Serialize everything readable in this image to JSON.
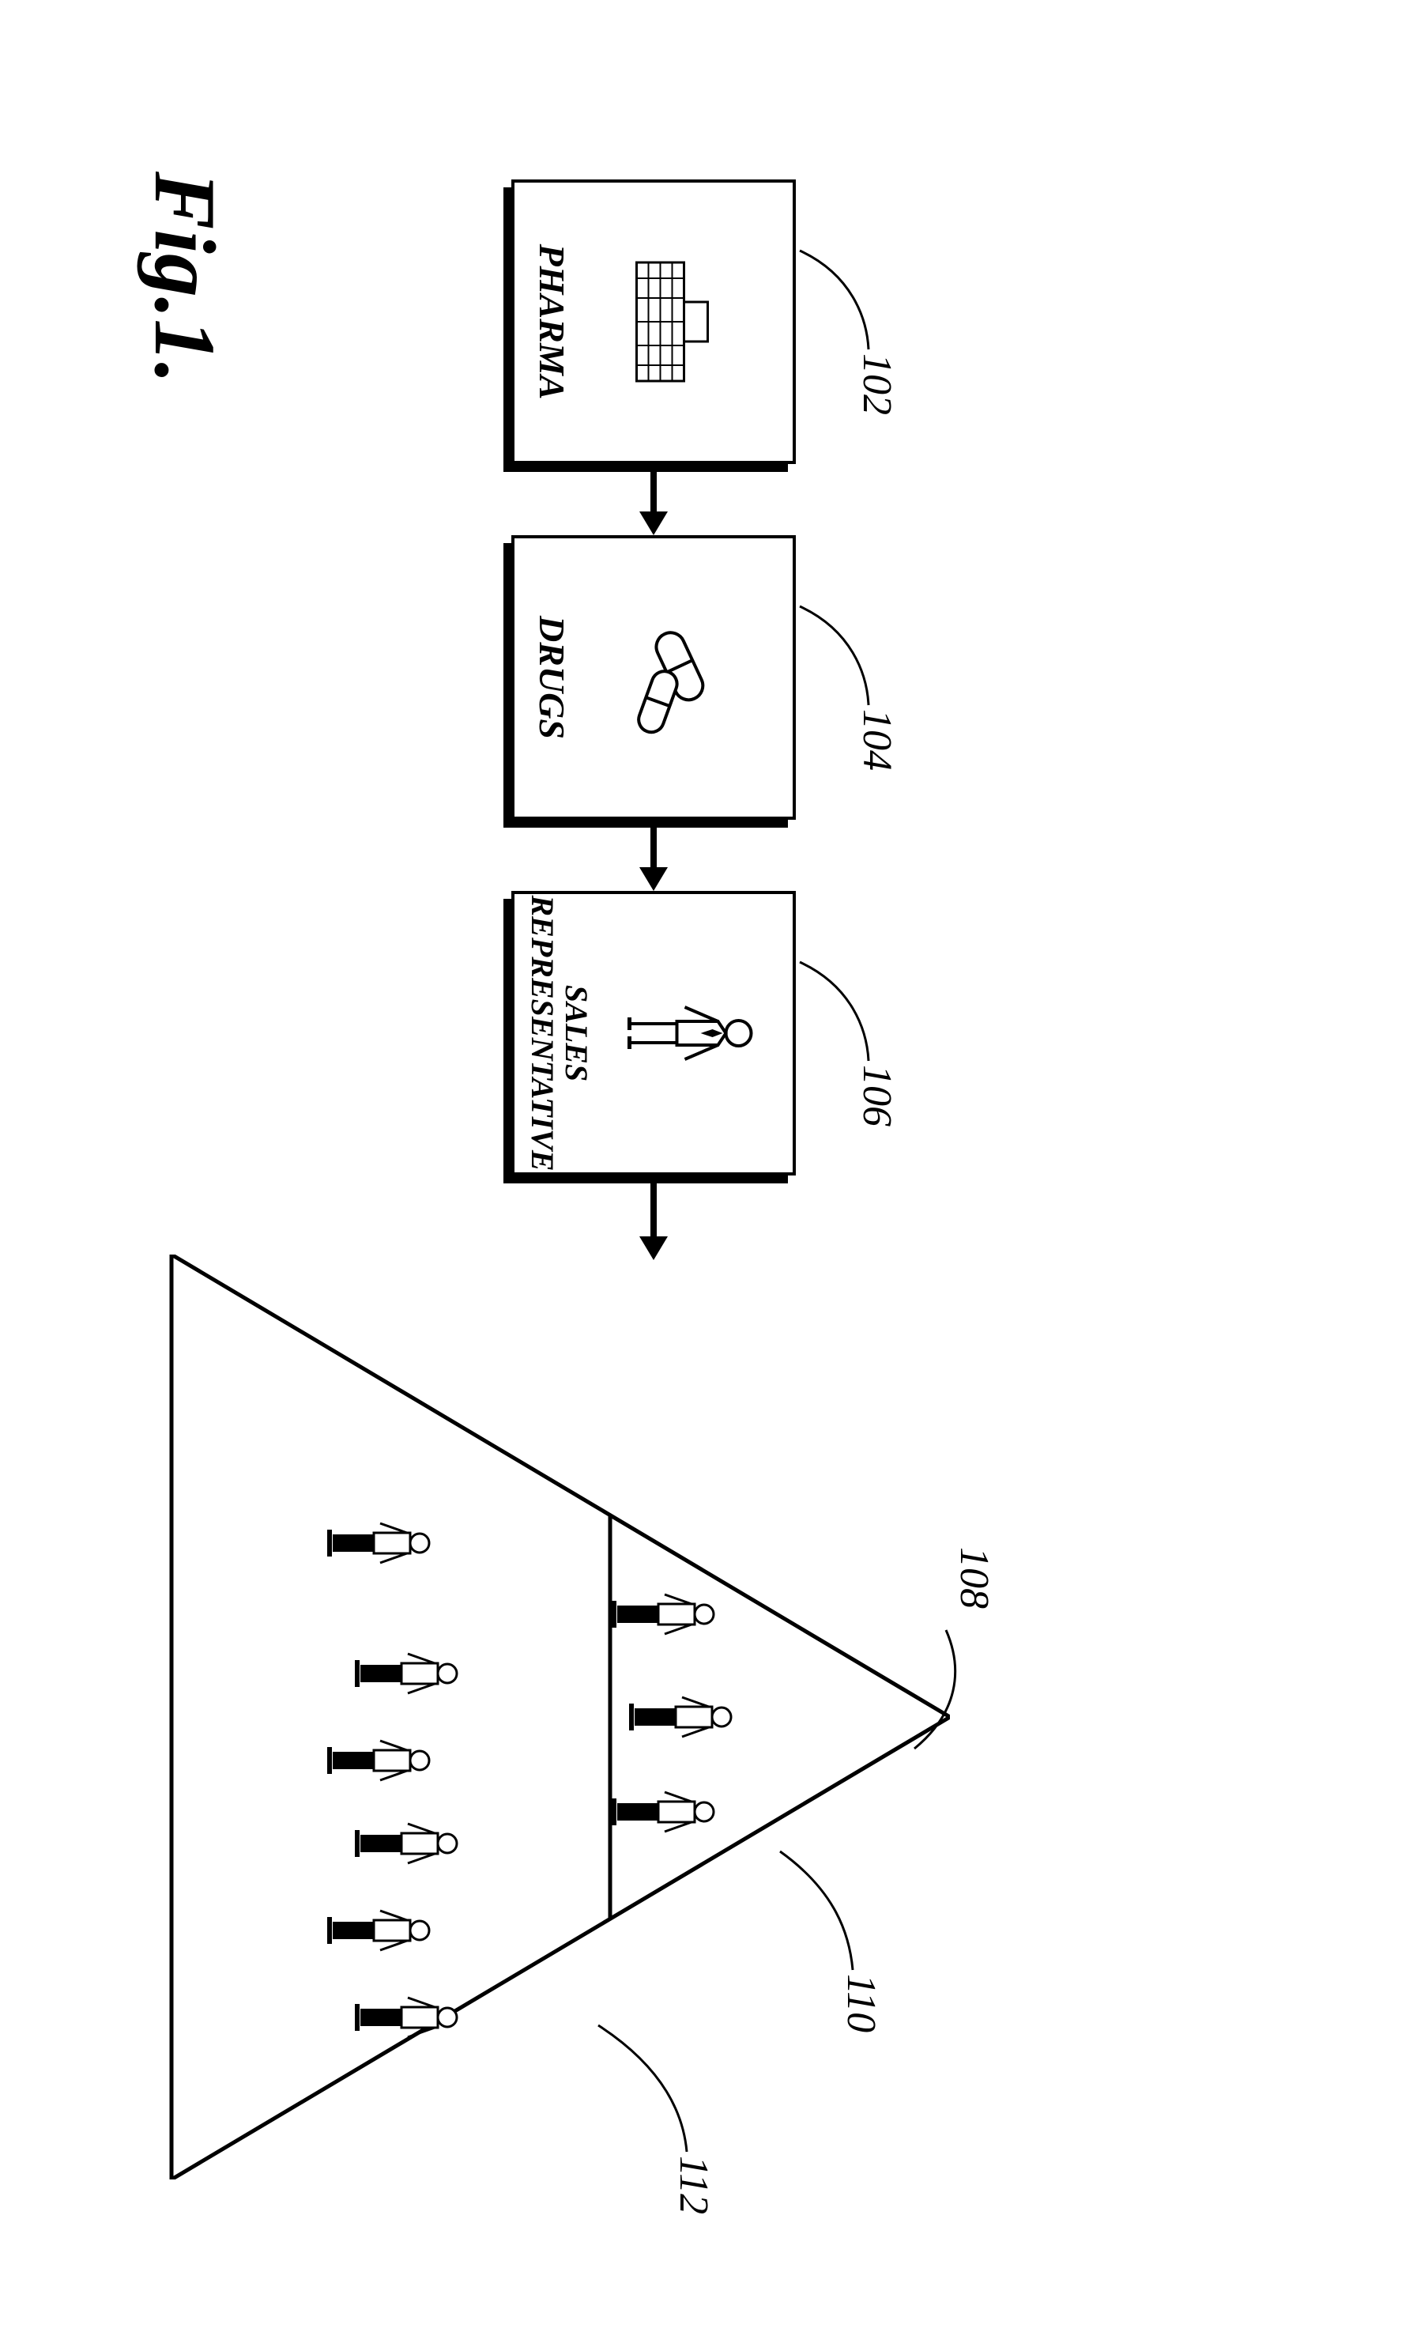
{
  "figure_label": "Fig.1.",
  "refs": {
    "pharma": "102",
    "drugs": "104",
    "sales": "106",
    "pyramid": "108",
    "tier_upper": "110",
    "tier_lower": "112"
  },
  "nodes": {
    "pharma": {
      "label": "PHARMA"
    },
    "drugs": {
      "label": "DRUGS"
    },
    "sales": {
      "label": "SALES\nREPRESENTATIVE"
    }
  }
}
